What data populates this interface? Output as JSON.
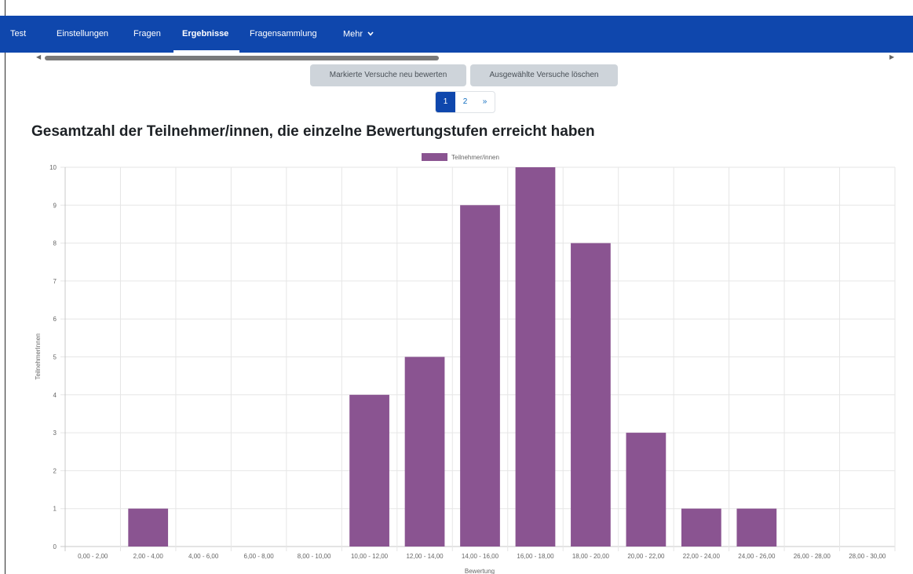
{
  "navbar": {
    "items": [
      {
        "label": "Test",
        "active": false
      },
      {
        "label": "Einstellungen",
        "active": false
      },
      {
        "label": "Fragen",
        "active": false
      },
      {
        "label": "Ergebnisse",
        "active": true
      },
      {
        "label": "Fragensammlung",
        "active": false
      },
      {
        "label": "Mehr",
        "active": false,
        "dropdown_icon": "chevron-down-icon"
      }
    ]
  },
  "actions": {
    "regrade_label": "Markierte Versuche neu bewerten",
    "delete_label": "Ausgewählte Versuche löschen"
  },
  "pagination": {
    "pages": [
      "1",
      "2"
    ],
    "next_label": "»",
    "current_page": 1
  },
  "colors": {
    "navbar": "#0f47ad",
    "bar": "#8a5491",
    "button": "#ced4da"
  },
  "chart_data": {
    "type": "bar",
    "title": "Gesamtzahl der Teilnehmer/innen, die einzelne Bewertungstufen erreicht haben",
    "xlabel": "Bewertung",
    "ylabel": "TeilnehmerInnen",
    "categories": [
      "0,00 - 2,00",
      "2,00 - 4,00",
      "4,00 - 6,00",
      "6,00 - 8,00",
      "8,00 - 10,00",
      "10,00 - 12,00",
      "12,00 - 14,00",
      "14,00 - 16,00",
      "16,00 - 18,00",
      "18,00 - 20,00",
      "20,00 - 22,00",
      "22,00 - 24,00",
      "24,00 - 26,00",
      "26,00 - 28,00",
      "28,00 - 30,00"
    ],
    "series": [
      {
        "name": "Teilnehmer/innen",
        "values": [
          0,
          1,
          0,
          0,
          0,
          4,
          5,
          9,
          10,
          8,
          3,
          1,
          1,
          0,
          0
        ]
      }
    ],
    "ylim": [
      0,
      10
    ],
    "yticks": [
      "0",
      "1",
      "2",
      "3",
      "4",
      "5",
      "6",
      "7",
      "8",
      "9",
      "10"
    ],
    "grid": true,
    "legend_position": "top"
  }
}
